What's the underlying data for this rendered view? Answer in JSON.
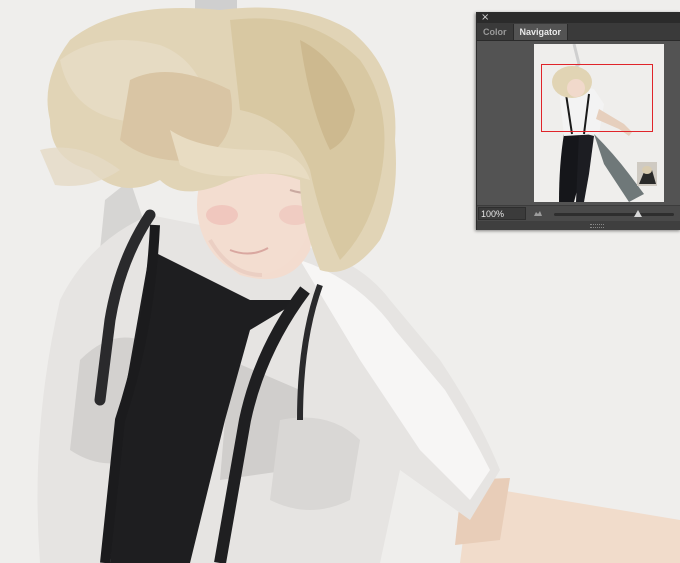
{
  "panel": {
    "close_glyph": "×",
    "tabs": [
      {
        "label": "Color",
        "active": false
      },
      {
        "label": "Navigator",
        "active": true
      }
    ],
    "zoom_level": "100%",
    "zoom_slider_value": 0.7,
    "view_rect_color": "#e0242a"
  },
  "canvas": {
    "background_color": "#efeeec",
    "content": "digital painting of a blonde dancer"
  }
}
